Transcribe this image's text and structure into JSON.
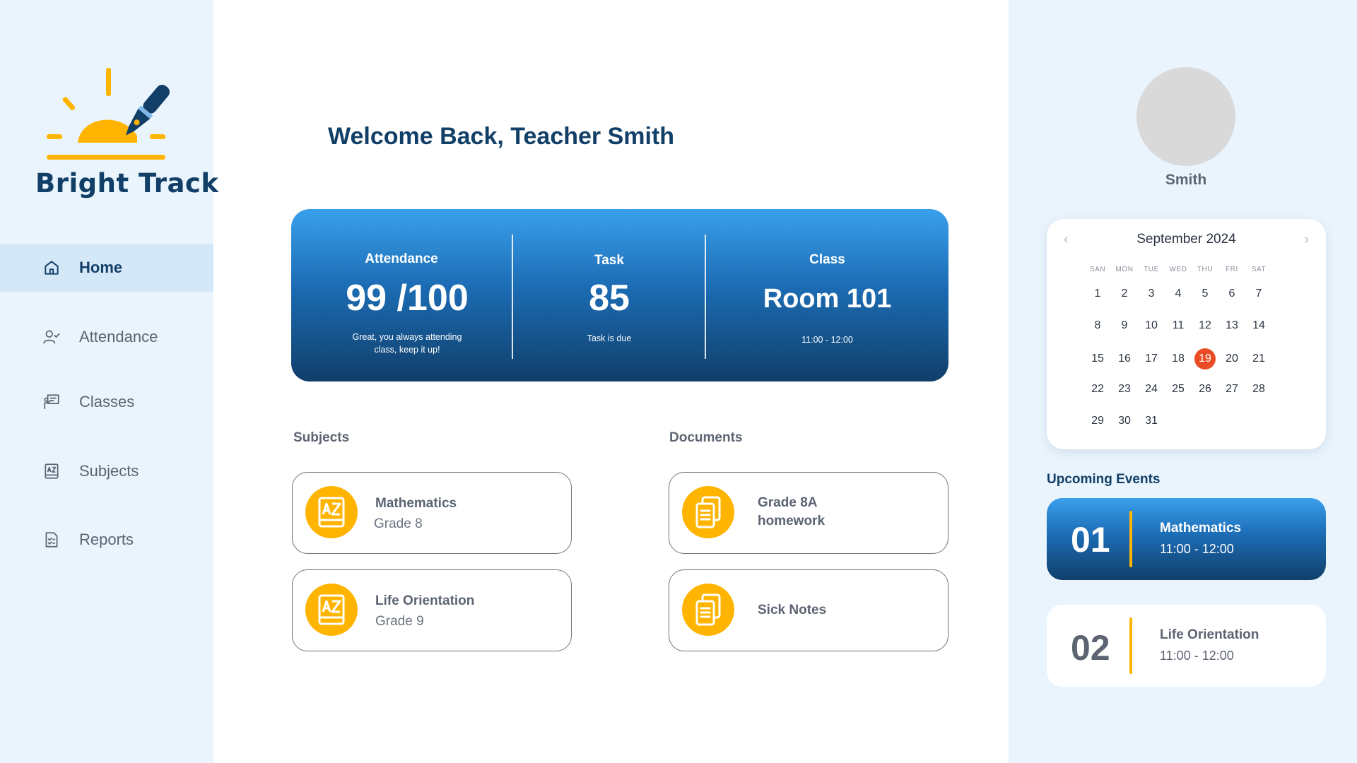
{
  "brand": {
    "name": "Bright Track"
  },
  "nav": [
    {
      "label": "Home",
      "icon": "home-icon",
      "active": true
    },
    {
      "label": "Attendance",
      "icon": "user-check-icon"
    },
    {
      "label": "Classes",
      "icon": "classroom-icon"
    },
    {
      "label": "Subjects",
      "icon": "book-az-icon"
    },
    {
      "label": "Reports",
      "icon": "report-icon"
    }
  ],
  "welcome": "Welcome Back, Teacher Smith",
  "stats": {
    "attendance": {
      "title": "Attendance",
      "value": "99 /100",
      "note": "Great, you always attending class, keep it up!"
    },
    "task": {
      "title": "Task",
      "value": "85",
      "note": "Task is due"
    },
    "class": {
      "title": "Class",
      "value": "Room 101",
      "note": "11:00 - 12:00"
    }
  },
  "subjects": {
    "title": "Subjects",
    "items": [
      {
        "name": "Mathematics",
        "grade": "Grade 8"
      },
      {
        "name": "Life Orientation",
        "grade": "Grade 9"
      }
    ]
  },
  "documents": {
    "title": "Documents",
    "items": [
      {
        "name": "Grade 8A homework"
      },
      {
        "name": "Sick Notes"
      }
    ]
  },
  "profile": {
    "name": "Smith"
  },
  "calendar": {
    "month": "September 2024",
    "prev": "‹",
    "next": "›",
    "days_of_week": [
      "SAN",
      "MON",
      "TUE",
      "WED",
      "THU",
      "FRI",
      "SAT"
    ],
    "weeks": [
      [
        "1",
        "2",
        "3",
        "4",
        "5",
        "6",
        "7"
      ],
      [
        "8",
        "9",
        "10",
        "11",
        "12",
        "13",
        "14"
      ],
      [
        "15",
        "16",
        "17",
        "18",
        "19",
        "20",
        "21"
      ],
      [
        "22",
        "23",
        "24",
        "25",
        "26",
        "27",
        "28"
      ],
      [
        "29",
        "30",
        "31"
      ]
    ],
    "today": "19"
  },
  "upcoming": {
    "title": "Upcoming Events",
    "events": [
      {
        "num": "01",
        "title": "Mathematics",
        "time": "11:00 - 12:00"
      },
      {
        "num": "02",
        "title": "Life Orientation",
        "time": "11:00 - 12:00"
      }
    ]
  },
  "colors": {
    "navy": "#113f67",
    "accent": "#ffb400",
    "today": "#ea4d25",
    "panel": "#eaf4fd"
  }
}
